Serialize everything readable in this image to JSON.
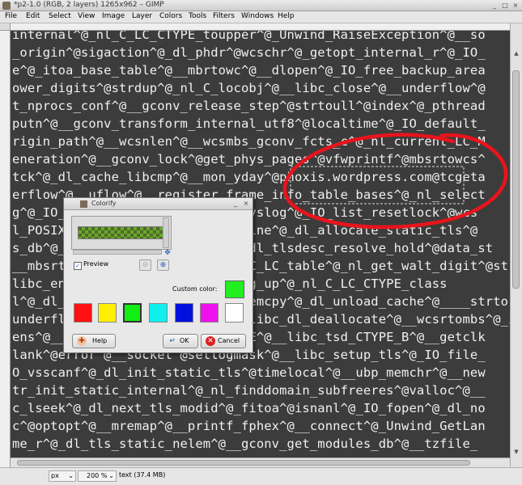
{
  "window": {
    "title": "*p2-1.0 (RGB, 2 layers) 1265x962 – GIMP",
    "controls": {
      "minimize": "_",
      "maximize": "□",
      "close": "×"
    }
  },
  "menu": [
    "File",
    "Edit",
    "Select",
    "View",
    "Image",
    "Layer",
    "Colors",
    "Tools",
    "Filters",
    "Windows",
    "Help"
  ],
  "canvas_text": [
    "internal^@_nl_C_LC_CTYPE_toupper^@_Unwind_RaiseException^@__so",
    "_origin^@sigaction^@_dl_phdr^@wcschr^@_getopt_internal_r^@_IO_",
    "e^@_itoa_base_table^@__mbrtowc^@__dlopen^@_IO_free_backup_area",
    "ower_digits^@strdup^@_nl_C_locobj^@__libc_close^@__underflow^@",
    "t_nprocs_conf^@__gconv_release_step^@strtoull^@index^@_pthread",
    "putn^@__gconv_transform_internal_utf8^@localtime^@_IO_default_",
    "rigin_path^@__wcsnlen^@__wcsmbs_gconv_fcts_c^@_nl_current_LC_M",
    "eneration^@__gconv_lock^@get_phys_pages^@vfwprintf^@mbsrtowcs^",
    "tck^@_dl_cache_libcmp^@__mon_yday^@phoxis.wordpress.com@tcgeta",
    "erflow^@__uflow^@__register_frame_info_table_bases^@_nl_select",
    "g^@_IO_seekmark^@_dl_start^@__syslog^@_IO_list_resetlock^@wcs",
    "l_POSIX_^@_nl_current_default_line^@_dl_allocate_static_tls^@",
    "s_db^@_nl_C_LC_CTYPE_class32^@_dl_tlsdesc_resolve_hold^@data_st",
    "__mbsrtowcs^@__libc_dlsym^@_nl_C_LC_table^@_nl_get_walt_digit^@strt",
    "libc_enable_secure^@_dl_starting_up^@_nl_C_LC_CTYPE_class",
    "l^@_dl_close^@_IO_list_lock^@_memcpy^@_dl_unload_cache^@____strto",
    "underflow^@_nl_C_locobj_ptr^@__libc_dl_deallocate^@__wcsrtombs^@_int_ma",
    "ens^@__libc_fork^@_nl_C_LC_CTYPE^@__libc_tsd_CTYPE_B^@__getclk",
    "lank^@error^@__socket^@setlogmask^@__libc_setup_tls^@_IO_file_",
    "O_vsscanf^@_dl_init_static_tls^@timelocal^@__ubp_memchr^@__new",
    "tr_init_static_internal^@_nl_finddomain_subfreeres^@valloc^@__",
    "c_lseek^@_dl_next_tls_modid^@_fitoa^@isnanl^@_IO_fopen^@_dl_no",
    "c^@optopt^@__mremap^@__printf_fphex^@__connect^@_Unwind_GetLan",
    "me_r^@_dl_tls_static_nelem^@__gconv_get_modules_db^@__tzfile_"
  ],
  "statusbar": {
    "unit": "px",
    "zoom": "200 %",
    "info": "text (37.4 MB)"
  },
  "annotation": {
    "color": "#e8141c"
  },
  "dialog": {
    "title": "Colorify",
    "preview_label": "Preview",
    "preview_checked": true,
    "custom_color_label": "Custom color:",
    "custom_color": "#22ee22",
    "swatches": [
      "#ff1111",
      "#ffee00",
      "#11ee11",
      "#11eeee",
      "#0011dd",
      "#ee11ee",
      "#ffffff"
    ],
    "selected_swatch": 2,
    "buttons": {
      "help": "Help",
      "ok": "OK",
      "cancel": "Cancel"
    }
  }
}
